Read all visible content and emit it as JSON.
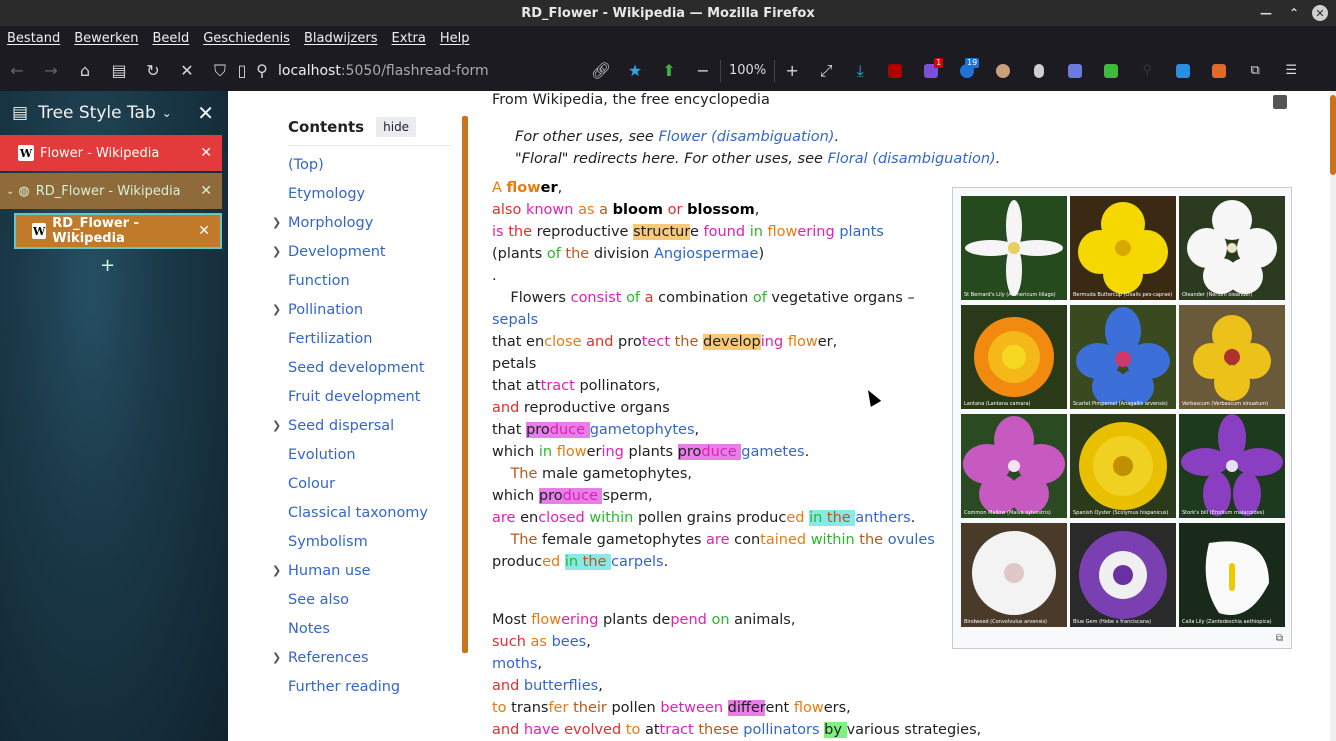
{
  "window": {
    "title": "RD_Flower - Wikipedia — Mozilla Firefox"
  },
  "menu": [
    "Bestand",
    "Bewerken",
    "Beeld",
    "Geschiedenis",
    "Bladwijzers",
    "Extra",
    "Help"
  ],
  "nav": {
    "url_host": "localhost",
    "url_path": ":5050/flashread-form",
    "zoom": "100%",
    "badge1": "1",
    "badge2": "19"
  },
  "sidebar": {
    "title": "Tree Style Tab",
    "tabs": [
      {
        "label": "Flower - Wikipedia"
      },
      {
        "label": "RD_Flower - Wikipedia"
      },
      {
        "label": "RD_Flower - Wikipedia"
      }
    ]
  },
  "toc": {
    "title": "Contents",
    "hide": "hide",
    "items": [
      "(Top)",
      "Etymology",
      "Morphology",
      "Development",
      "Function",
      "Pollination",
      "Fertilization",
      "Seed development",
      "Fruit development",
      "Seed dispersal",
      "Evolution",
      "Colour",
      "Classical taxonomy",
      "Symbolism",
      "Human use",
      "See also",
      "Notes",
      "References",
      "Further reading"
    ]
  },
  "article": {
    "tagline": "From Wikipedia, the free encyclopedia",
    "hatnote1_pre": "For other uses, see ",
    "hatnote1_link": "Flower (disambiguation)",
    "hatnote2_pre": "\"Floral\" redirects here. For other uses, see ",
    "hatnote2_link": "Floral (disambiguation)"
  },
  "gallery": {
    "captions": [
      "St Bernard's Lily (Anthericum liliago)",
      "Bermuda Buttercup (Oxalis pes-caprae)",
      "Oleander (Nerium oleander)",
      "Lantana (Lantana camara)",
      "Scarlet Pimpernel (Anagallis arvensis)",
      "Verbascum (Verbascum sinuatum)",
      "Common Mallow (Malva sylvestris)",
      "Spanish Oyster (Scolymus hispanicus)",
      "Stork's bill (Erodium malacoides)",
      "Bindweed (Convolvulus arvensis)",
      "Blue Gem (Hebe x franciscana)",
      "Calla Lily (Zantedeschia aethiopica)"
    ],
    "colors": [
      "#f5f5f5",
      "#f5d800",
      "#f7f7f7",
      "#f28a10",
      "#3d6fd8",
      "#ecc11a",
      "#c65ac0",
      "#e8c000",
      "#8a3fc2",
      "#f3f3f3",
      "#7a3fb0",
      "#fafafa"
    ]
  }
}
